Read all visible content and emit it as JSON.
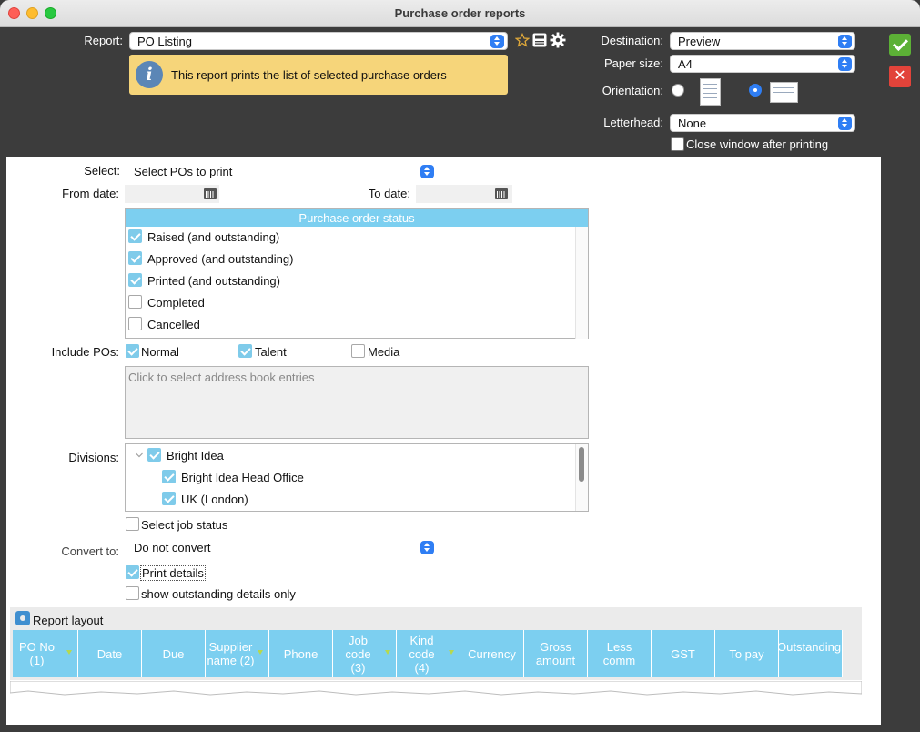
{
  "window": {
    "title": "Purchase order reports"
  },
  "report": {
    "label": "Report:",
    "value": "PO Listing",
    "info": "This report prints the list of selected purchase orders"
  },
  "destination": {
    "label": "Destination:",
    "value": "Preview"
  },
  "paper_size": {
    "label": "Paper size:",
    "value": "A4"
  },
  "orientation": {
    "label": "Orientation:",
    "selected": "landscape"
  },
  "letterhead": {
    "label": "Letterhead:",
    "value": "None"
  },
  "close_after_printing": {
    "label": "Close window after printing",
    "checked": false
  },
  "select": {
    "label": "Select:",
    "value": "Select POs to print"
  },
  "from_date": {
    "label": "From date:",
    "value": ""
  },
  "to_date": {
    "label": "To date:",
    "value": ""
  },
  "po_status": {
    "header": "Purchase order status",
    "items": [
      {
        "label": "Raised (and outstanding)",
        "checked": true
      },
      {
        "label": "Approved (and outstanding)",
        "checked": true
      },
      {
        "label": "Printed (and outstanding)",
        "checked": true
      },
      {
        "label": "Completed",
        "checked": false
      },
      {
        "label": "Cancelled",
        "checked": false
      }
    ]
  },
  "include_pos": {
    "label": "Include POs:",
    "items": [
      {
        "label": "Normal",
        "checked": true
      },
      {
        "label": "Talent",
        "checked": true
      },
      {
        "label": "Media",
        "checked": false
      }
    ]
  },
  "address_book": {
    "placeholder": "Click to select address book entries"
  },
  "divisions": {
    "label": "Divisions:",
    "items": [
      {
        "label": "Bright Idea",
        "checked": true,
        "level": 0
      },
      {
        "label": "Bright Idea Head Office",
        "checked": true,
        "level": 1
      },
      {
        "label": "UK (London)",
        "checked": true,
        "level": 1
      }
    ]
  },
  "select_job_status": {
    "label": "Select job status",
    "checked": false
  },
  "convert_to": {
    "label": "Convert to:",
    "value": "Do not convert"
  },
  "print_details": {
    "label": "Print details",
    "checked": true
  },
  "show_outstanding": {
    "label": "show outstanding details only",
    "checked": false
  },
  "report_layout": {
    "label": "Report layout",
    "columns": [
      {
        "label": "PO No (1)",
        "filter": true
      },
      {
        "label": "Date",
        "filter": false
      },
      {
        "label": "Due",
        "filter": false
      },
      {
        "label": "Supplier name (2)",
        "filter": true
      },
      {
        "label": "Phone",
        "filter": false
      },
      {
        "label": "Job code (3)",
        "filter": true
      },
      {
        "label": "Kind code (4)",
        "filter": true
      },
      {
        "label": "Currency",
        "filter": false
      },
      {
        "label": "Gross amount",
        "filter": false
      },
      {
        "label": "Less comm",
        "filter": false
      },
      {
        "label": "GST",
        "filter": false
      },
      {
        "label": "To pay",
        "filter": false
      },
      {
        "label": "Outstanding",
        "filter": false
      }
    ]
  },
  "colors": {
    "accent": "#2f7ef4",
    "header_blue": "#7ccff0",
    "info_bg": "#f6d57a",
    "ok": "#5cb036",
    "cancel": "#e2433a"
  },
  "icons": [
    "star-icon",
    "save-icon",
    "gear-icon",
    "info-icon",
    "calendar-icon",
    "checkmark-icon",
    "close-icon"
  ]
}
